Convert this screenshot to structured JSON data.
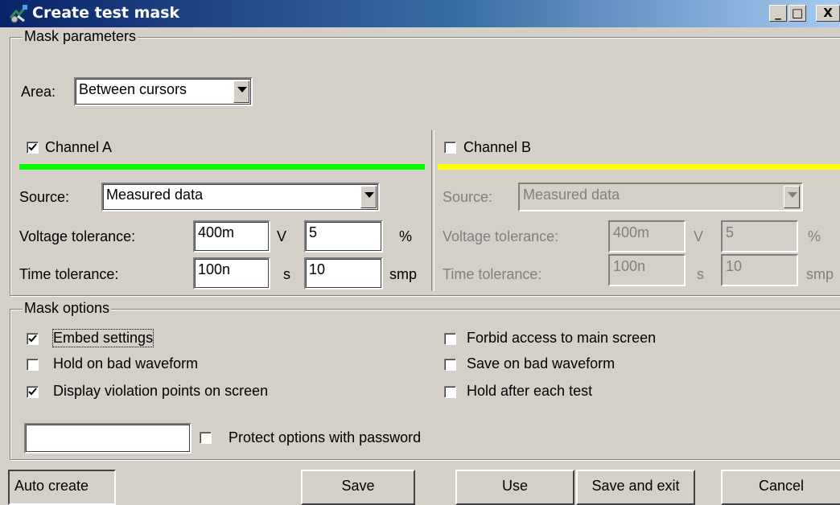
{
  "window": {
    "title": "Create test mask",
    "min_label": "_",
    "max_label": "□",
    "close_label": "X"
  },
  "mask_parameters": {
    "group_label": "Mask parameters",
    "area_label": "Area:",
    "area_value": "Between cursors",
    "channel_a": {
      "label": "Channel A",
      "checked": true,
      "color": "#00ff00",
      "source_label": "Source:",
      "source_value": "Measured data",
      "voltage_label": "Voltage tolerance:",
      "voltage_value": "400m",
      "voltage_unit": "V",
      "voltage_pct": "5",
      "pct_unit": "%",
      "time_label": "Time tolerance:",
      "time_value": "100n",
      "time_unit": "s",
      "time_smp": "10",
      "smp_unit": "smp"
    },
    "channel_b": {
      "label": "Channel B",
      "checked": false,
      "color": "#ffff00",
      "source_label": "Source:",
      "source_value": "Measured data",
      "voltage_label": "Voltage tolerance:",
      "voltage_value": "400m",
      "voltage_unit": "V",
      "voltage_pct": "5",
      "pct_unit": "%",
      "time_label": "Time tolerance:",
      "time_value": "100n",
      "time_unit": "s",
      "time_smp": "10",
      "smp_unit": "smp"
    }
  },
  "mask_options": {
    "group_label": "Mask options",
    "embed_settings": {
      "label": "Embed settings",
      "checked": true
    },
    "hold_on_bad": {
      "label": "Hold on bad waveform",
      "checked": false
    },
    "display_violation": {
      "label": "Display violation points on screen",
      "checked": true
    },
    "forbid_access": {
      "label": "Forbid access to main screen",
      "checked": false
    },
    "save_on_bad": {
      "label": "Save on bad waveform",
      "checked": false
    },
    "hold_after_test": {
      "label": "Hold after each test",
      "checked": false
    },
    "password_value": "",
    "protect": {
      "label": "Protect options with password",
      "checked": false
    }
  },
  "buttons": {
    "auto_create": "Auto create",
    "save": "Save",
    "use": "Use",
    "save_and_exit": "Save and exit",
    "cancel": "Cancel"
  }
}
